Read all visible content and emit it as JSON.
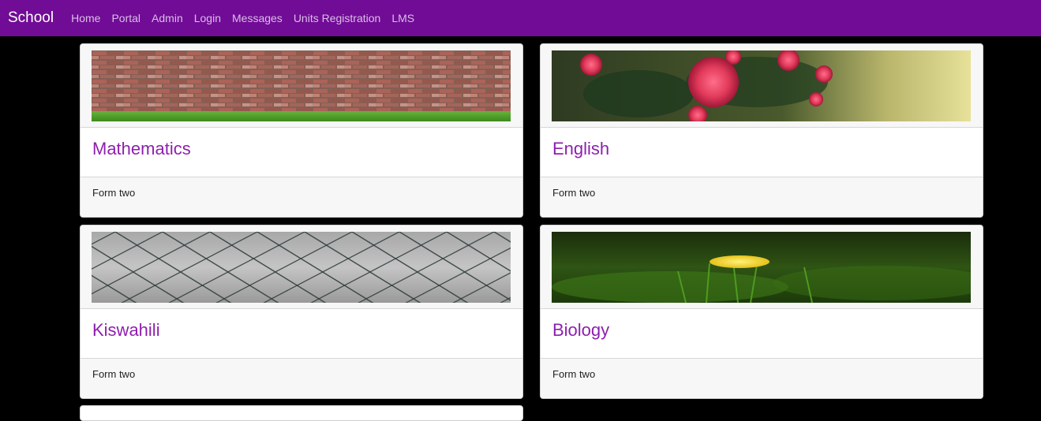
{
  "nav": {
    "brand": "School",
    "links": [
      "Home",
      "Portal",
      "Admin",
      "Login",
      "Messages",
      "Units Registration",
      "LMS"
    ]
  },
  "colors": {
    "navbar": "#710c96",
    "title": "#8e1fae",
    "page_background": "#000000"
  },
  "cards": [
    {
      "title": "Mathematics",
      "footer": "Form two",
      "image": "brick-wall-with-grass"
    },
    {
      "title": "English",
      "footer": "Form two",
      "image": "pink-roses"
    },
    {
      "title": "Kiswahili",
      "footer": "Form two",
      "image": "chain-link-fence"
    },
    {
      "title": "Biology",
      "footer": "Form two",
      "image": "yellow-flower-in-grass"
    }
  ]
}
